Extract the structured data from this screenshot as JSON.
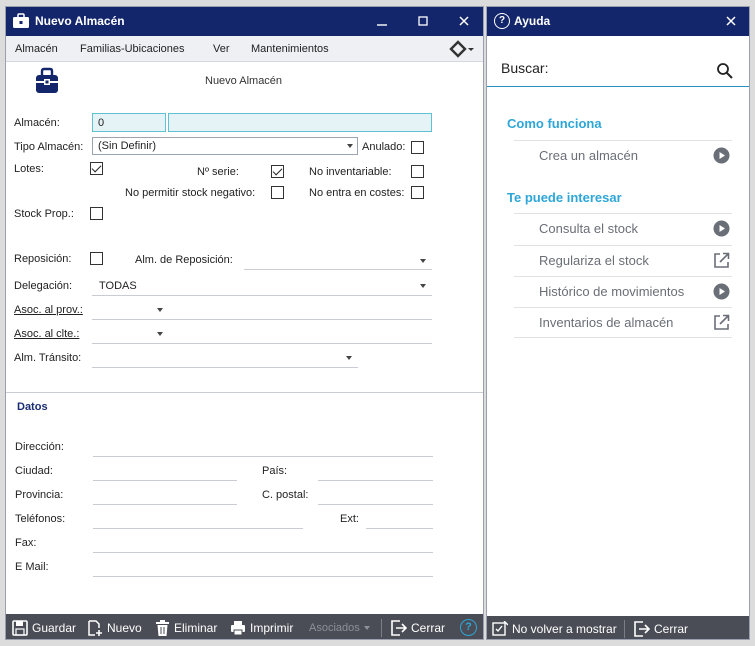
{
  "main_window": {
    "title": "Nuevo Almacén",
    "menu": [
      "Almacén",
      "Familias-Ubicaciones",
      "Ver",
      "Mantenimientos"
    ],
    "form_title": "Nuevo Almacén",
    "fields": {
      "almacen_label": "Almacén:",
      "almacen_code": "0",
      "almacen_name": "",
      "tipo_label": "Tipo Almacén:",
      "tipo_value": "(Sin Definir)",
      "anulado_label": "Anulado:",
      "lotes_label": "Lotes:",
      "nserie_label": "Nº serie:",
      "no_inventariable_label": "No inventariable:",
      "no_stock_neg_label": "No permitir stock negativo:",
      "no_costes_label": "No entra en costes:",
      "stock_prop_label": "Stock Prop.:",
      "reposicion_label": "Reposición:",
      "alm_reposicion_label": "Alm. de Reposición:",
      "delegacion_label": "Delegación:",
      "delegacion_value": "TODAS",
      "asoc_prov_label": "Asoc. al prov.:",
      "asoc_clte_label": "Asoc. al clte.:",
      "alm_transito_label": "Alm. Tránsito:"
    },
    "checkboxes": {
      "anulado": false,
      "lotes": true,
      "nserie": true,
      "no_inventariable": false,
      "no_stock_neg": false,
      "no_costes": false,
      "stock_prop": false,
      "reposicion": false
    },
    "datos": {
      "title": "Datos",
      "direccion": "Dirección:",
      "ciudad": "Ciudad:",
      "pais": "País:",
      "provincia": "Provincia:",
      "cpostal": "C. postal:",
      "telefonos": "Teléfonos:",
      "ext": "Ext:",
      "fax": "Fax:",
      "email": "E Mail:"
    },
    "footer": {
      "guardar": "Guardar",
      "nuevo": "Nuevo",
      "eliminar": "Eliminar",
      "imprimir": "Imprimir",
      "asociados": "Asociados",
      "cerrar": "Cerrar",
      "help": "?"
    }
  },
  "help_window": {
    "title": "Ayuda",
    "search_label": "Buscar:",
    "section1": "Como funciona",
    "section1_items": [
      {
        "label": "Crea un almacén",
        "icon": "play-icon"
      }
    ],
    "section2": "Te puede interesar",
    "section2_items": [
      {
        "label": "Consulta el stock",
        "icon": "play-icon"
      },
      {
        "label": "Regulariza el stock",
        "icon": "external-link-icon"
      },
      {
        "label": "Histórico de movimientos",
        "icon": "play-icon"
      },
      {
        "label": "Inventarios de almacén",
        "icon": "external-link-icon"
      }
    ],
    "footer": {
      "no_volver": "No volver a mostrar",
      "cerrar": "Cerrar"
    }
  },
  "colors": {
    "titlebar": "#14266b",
    "accent": "#2ea6d8",
    "footer": "#4a4d55"
  }
}
